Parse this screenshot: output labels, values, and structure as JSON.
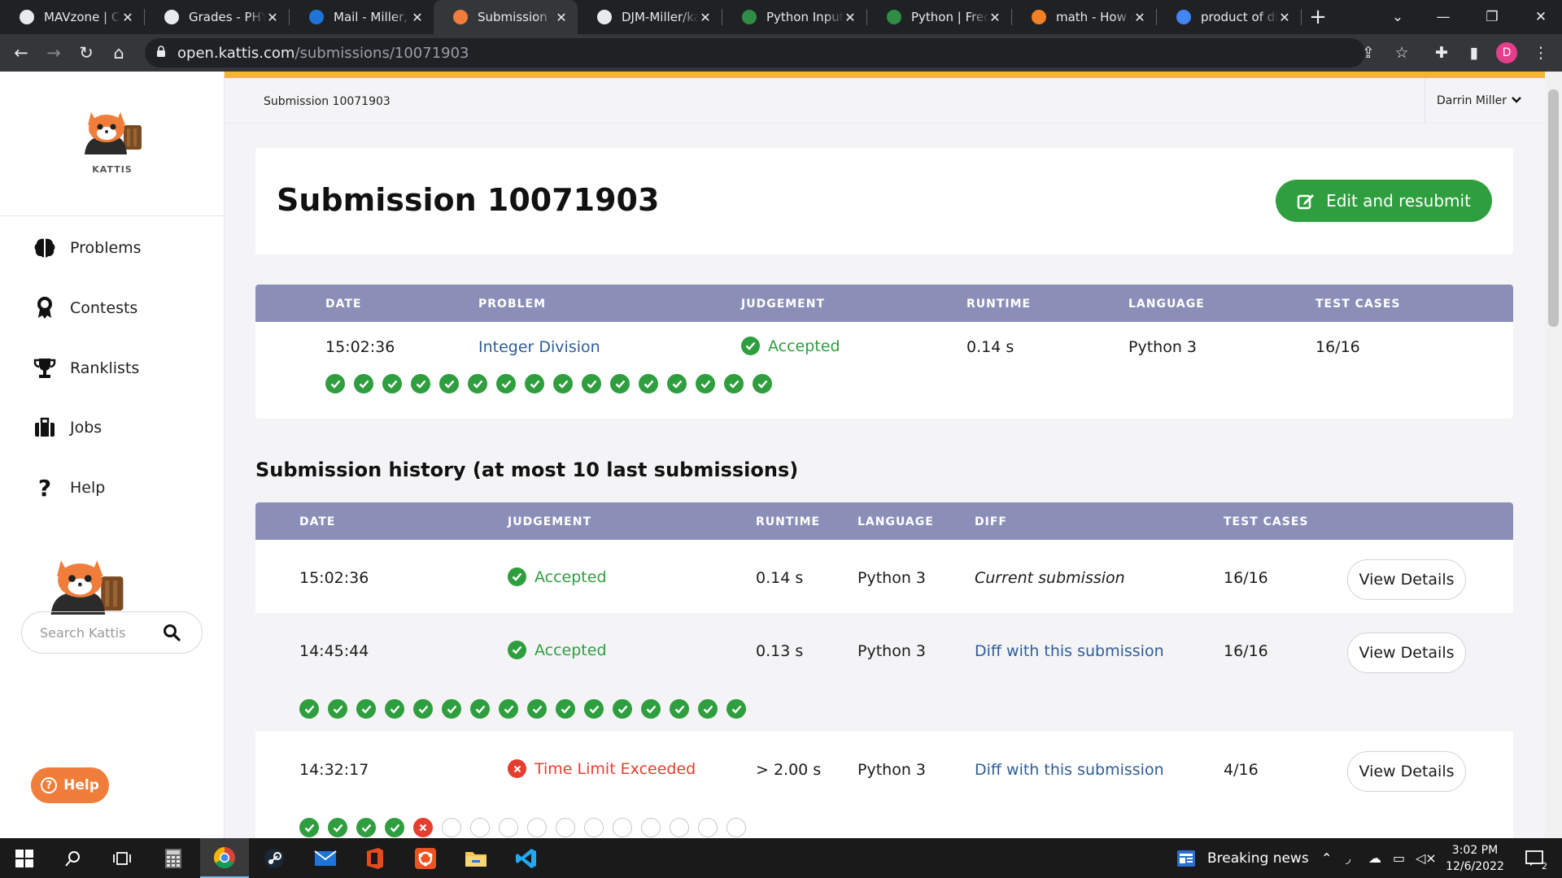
{
  "browser": {
    "tabs": [
      {
        "label": "MAVzone | Co",
        "icon": "mavzone-icon",
        "active": false
      },
      {
        "label": "Grades - PHYS",
        "icon": "d2l-icon",
        "active": false
      },
      {
        "label": "Mail - Miller, D",
        "icon": "outlook-icon",
        "active": false
      },
      {
        "label": "Submission 10",
        "icon": "kattis-icon",
        "active": true
      },
      {
        "label": "DJM-Miller/ka",
        "icon": "github-icon",
        "active": false
      },
      {
        "label": "Python Input",
        "icon": "gfg-icon",
        "active": false
      },
      {
        "label": "Python | Frequ",
        "icon": "gfg-icon",
        "active": false
      },
      {
        "label": "math - How d",
        "icon": "stackexchange-icon",
        "active": false
      },
      {
        "label": "product of div",
        "icon": "google-icon",
        "active": false
      }
    ],
    "url_host": "open.kattis.com",
    "url_path": "/submissions/10071903",
    "profile_initial": "D"
  },
  "sidebar": {
    "brand": "KATTIS",
    "nav": [
      {
        "label": "Problems",
        "icon": "brain-icon"
      },
      {
        "label": "Contests",
        "icon": "medal-icon"
      },
      {
        "label": "Ranklists",
        "icon": "trophy-icon"
      },
      {
        "label": "Jobs",
        "icon": "briefcase-icon"
      },
      {
        "label": "Help",
        "icon": "question-icon"
      }
    ],
    "search_placeholder": "Search Kattis",
    "help_button": "Help"
  },
  "topbar": {
    "breadcrumb": "Submission 10071903",
    "user_name": "Darrin Miller"
  },
  "submission": {
    "title": "Submission 10071903",
    "edit_button": "Edit and resubmit",
    "headers": [
      "DATE",
      "PROBLEM",
      "JUDGEMENT",
      "RUNTIME",
      "LANGUAGE",
      "TEST CASES"
    ],
    "date": "15:02:36",
    "problem": "Integer Division",
    "judgement": "Accepted",
    "runtime": "0.14 s",
    "language": "Python 3",
    "test_cases": "16/16",
    "passed": 16,
    "failed_at": null,
    "total": 16
  },
  "history": {
    "title": "Submission history (at most 10 last submissions)",
    "headers": [
      "DATE",
      "JUDGEMENT",
      "RUNTIME",
      "LANGUAGE",
      "DIFF",
      "TEST CASES"
    ],
    "view_label": "View Details",
    "rows": [
      {
        "date": "15:02:36",
        "judgement": "Accepted",
        "status": "ok",
        "runtime": "0.14 s",
        "language": "Python 3",
        "diff": "Current submission",
        "test_cases": "16/16",
        "passed": 0,
        "failed": 0,
        "total": 0
      },
      {
        "date": "14:45:44",
        "judgement": "Accepted",
        "status": "ok",
        "runtime": "0.13 s",
        "language": "Python 3",
        "diff": "Diff with this submission",
        "test_cases": "16/16",
        "passed": 16,
        "failed": 0,
        "total": 16
      },
      {
        "date": "14:32:17",
        "judgement": "Time Limit Exceeded",
        "status": "bad",
        "runtime": "> 2.00 s",
        "language": "Python 3",
        "diff": "Diff with this submission",
        "test_cases": "4/16",
        "passed": 4,
        "failed": 1,
        "total": 16
      }
    ]
  },
  "taskbar": {
    "news": "Breaking news",
    "time": "3:02 PM",
    "date": "12/6/2022",
    "notifications": "2"
  },
  "colors": {
    "accent_green": "#2e9e3e",
    "error_red": "#e53e2e",
    "table_header": "#8b8fb8",
    "link_blue": "#2f5d99",
    "top_stripe": "#f3b33d",
    "help_orange": "#f07d3a"
  }
}
